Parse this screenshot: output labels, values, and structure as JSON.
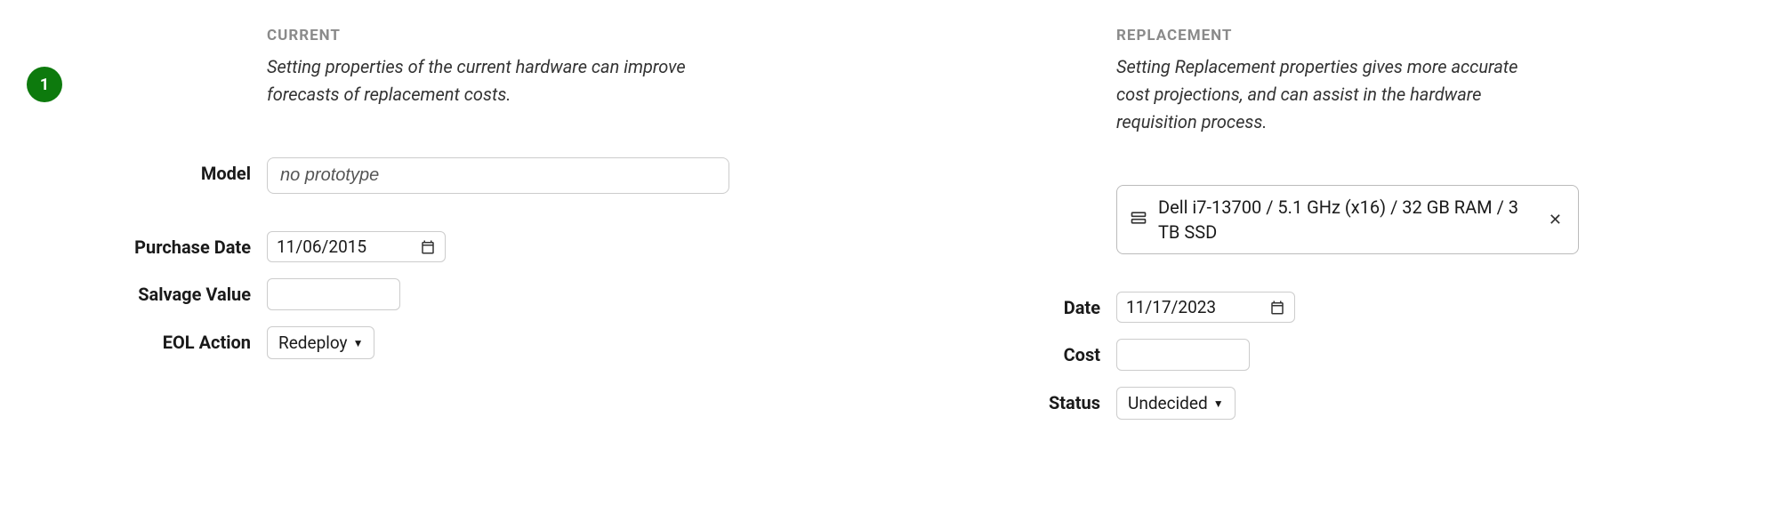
{
  "badge": "1",
  "current": {
    "title": "Current",
    "description": "Setting properties of the current hardware can improve forecasts of replacement costs.",
    "model_label": "Model",
    "model_value": "no prototype",
    "purchase_date_label": "Purchase Date",
    "purchase_date_value": "11/06/2015",
    "salvage_label": "Salvage Value",
    "salvage_value": "",
    "eol_label": "EOL Action",
    "eol_value": "Redeploy"
  },
  "replacement": {
    "title": "Replacement",
    "description": "Setting Replacement properties gives more accurate cost projections, and can assist in the hardware requisition process.",
    "model_label": "",
    "model_value": "Dell i7-13700 / 5.1 GHz (x16) / 32 GB RAM / 3 TB SSD",
    "date_label": "Date",
    "date_value": "11/17/2023",
    "cost_label": "Cost",
    "cost_value": "",
    "status_label": "Status",
    "status_value": "Undecided"
  }
}
